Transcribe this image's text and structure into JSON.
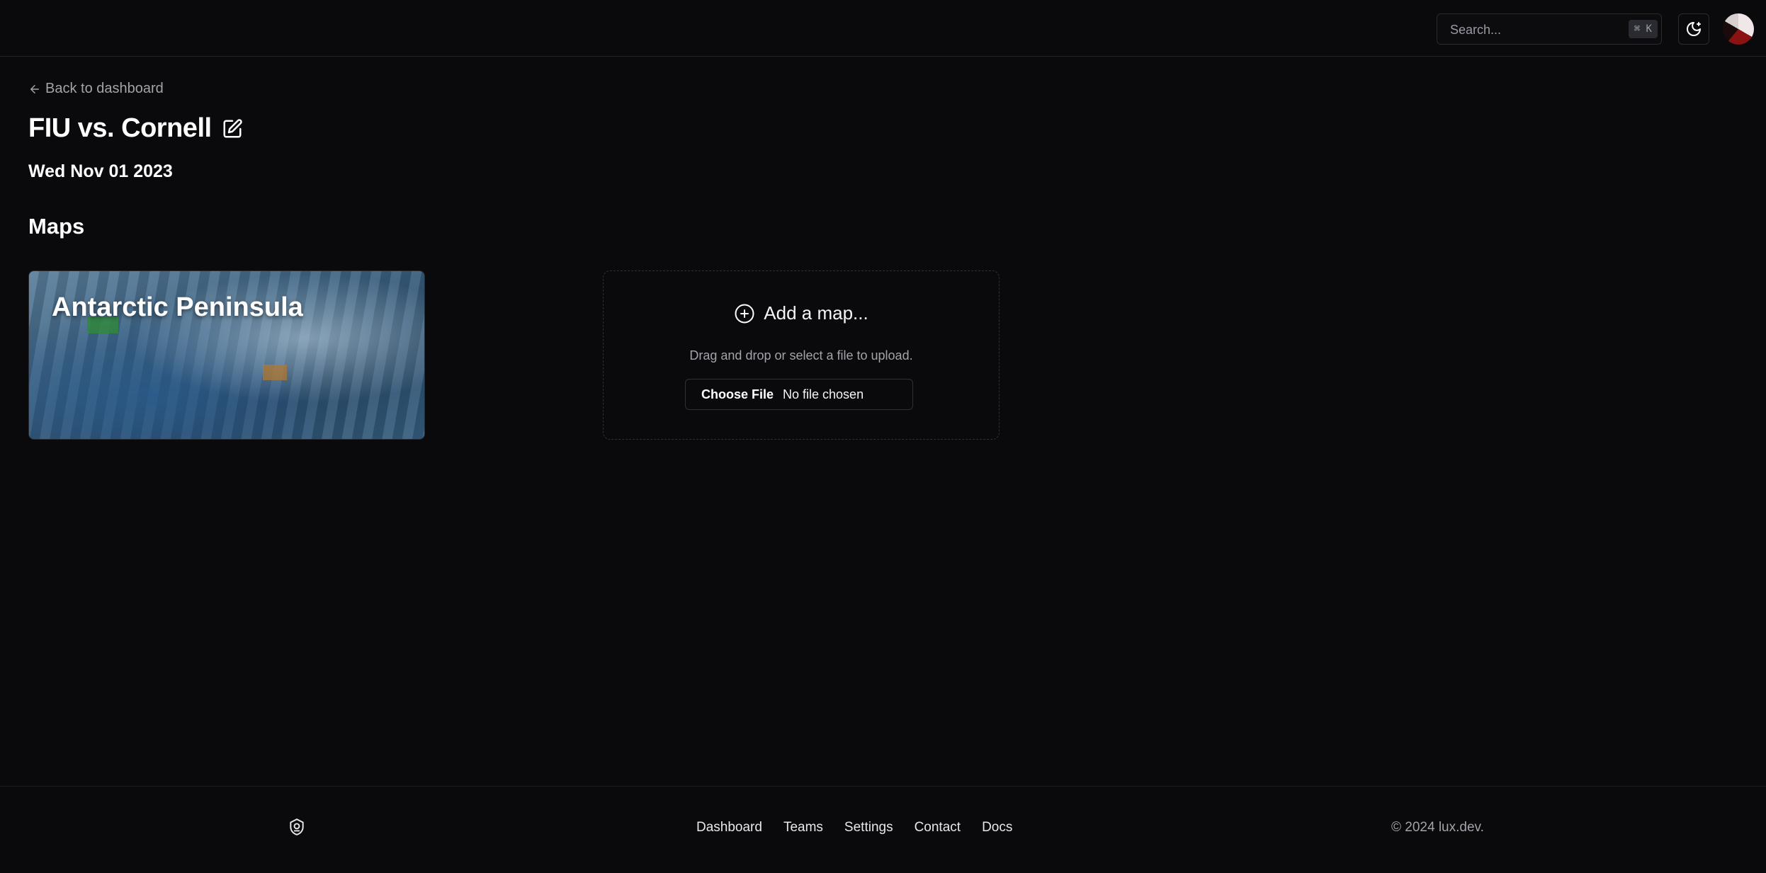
{
  "header": {
    "search_placeholder": "Search...",
    "search_shortcut": "⌘ K"
  },
  "back_link": "Back to dashboard",
  "match": {
    "title": "FIU vs. Cornell",
    "date": "Wed Nov 01 2023"
  },
  "maps": {
    "heading": "Maps",
    "items": [
      {
        "name": "Antarctic Peninsula"
      }
    ],
    "add": {
      "title": "Add a map...",
      "hint": "Drag and drop or select a file to upload.",
      "choose_label": "Choose File",
      "file_status": "No file chosen"
    }
  },
  "footer": {
    "nav": [
      "Dashboard",
      "Teams",
      "Settings",
      "Contact",
      "Docs"
    ],
    "copyright": "© 2024 lux.dev."
  },
  "icons": {
    "header": [
      "moon-icon",
      "avatar"
    ],
    "title": "edit-icon",
    "back": "arrow-left-icon",
    "add": "plus-circle-icon",
    "footer": "logo-icon"
  },
  "colors": {
    "background": "#0a0a0c",
    "border": "#222327",
    "muted_text": "#a3a4ab"
  }
}
